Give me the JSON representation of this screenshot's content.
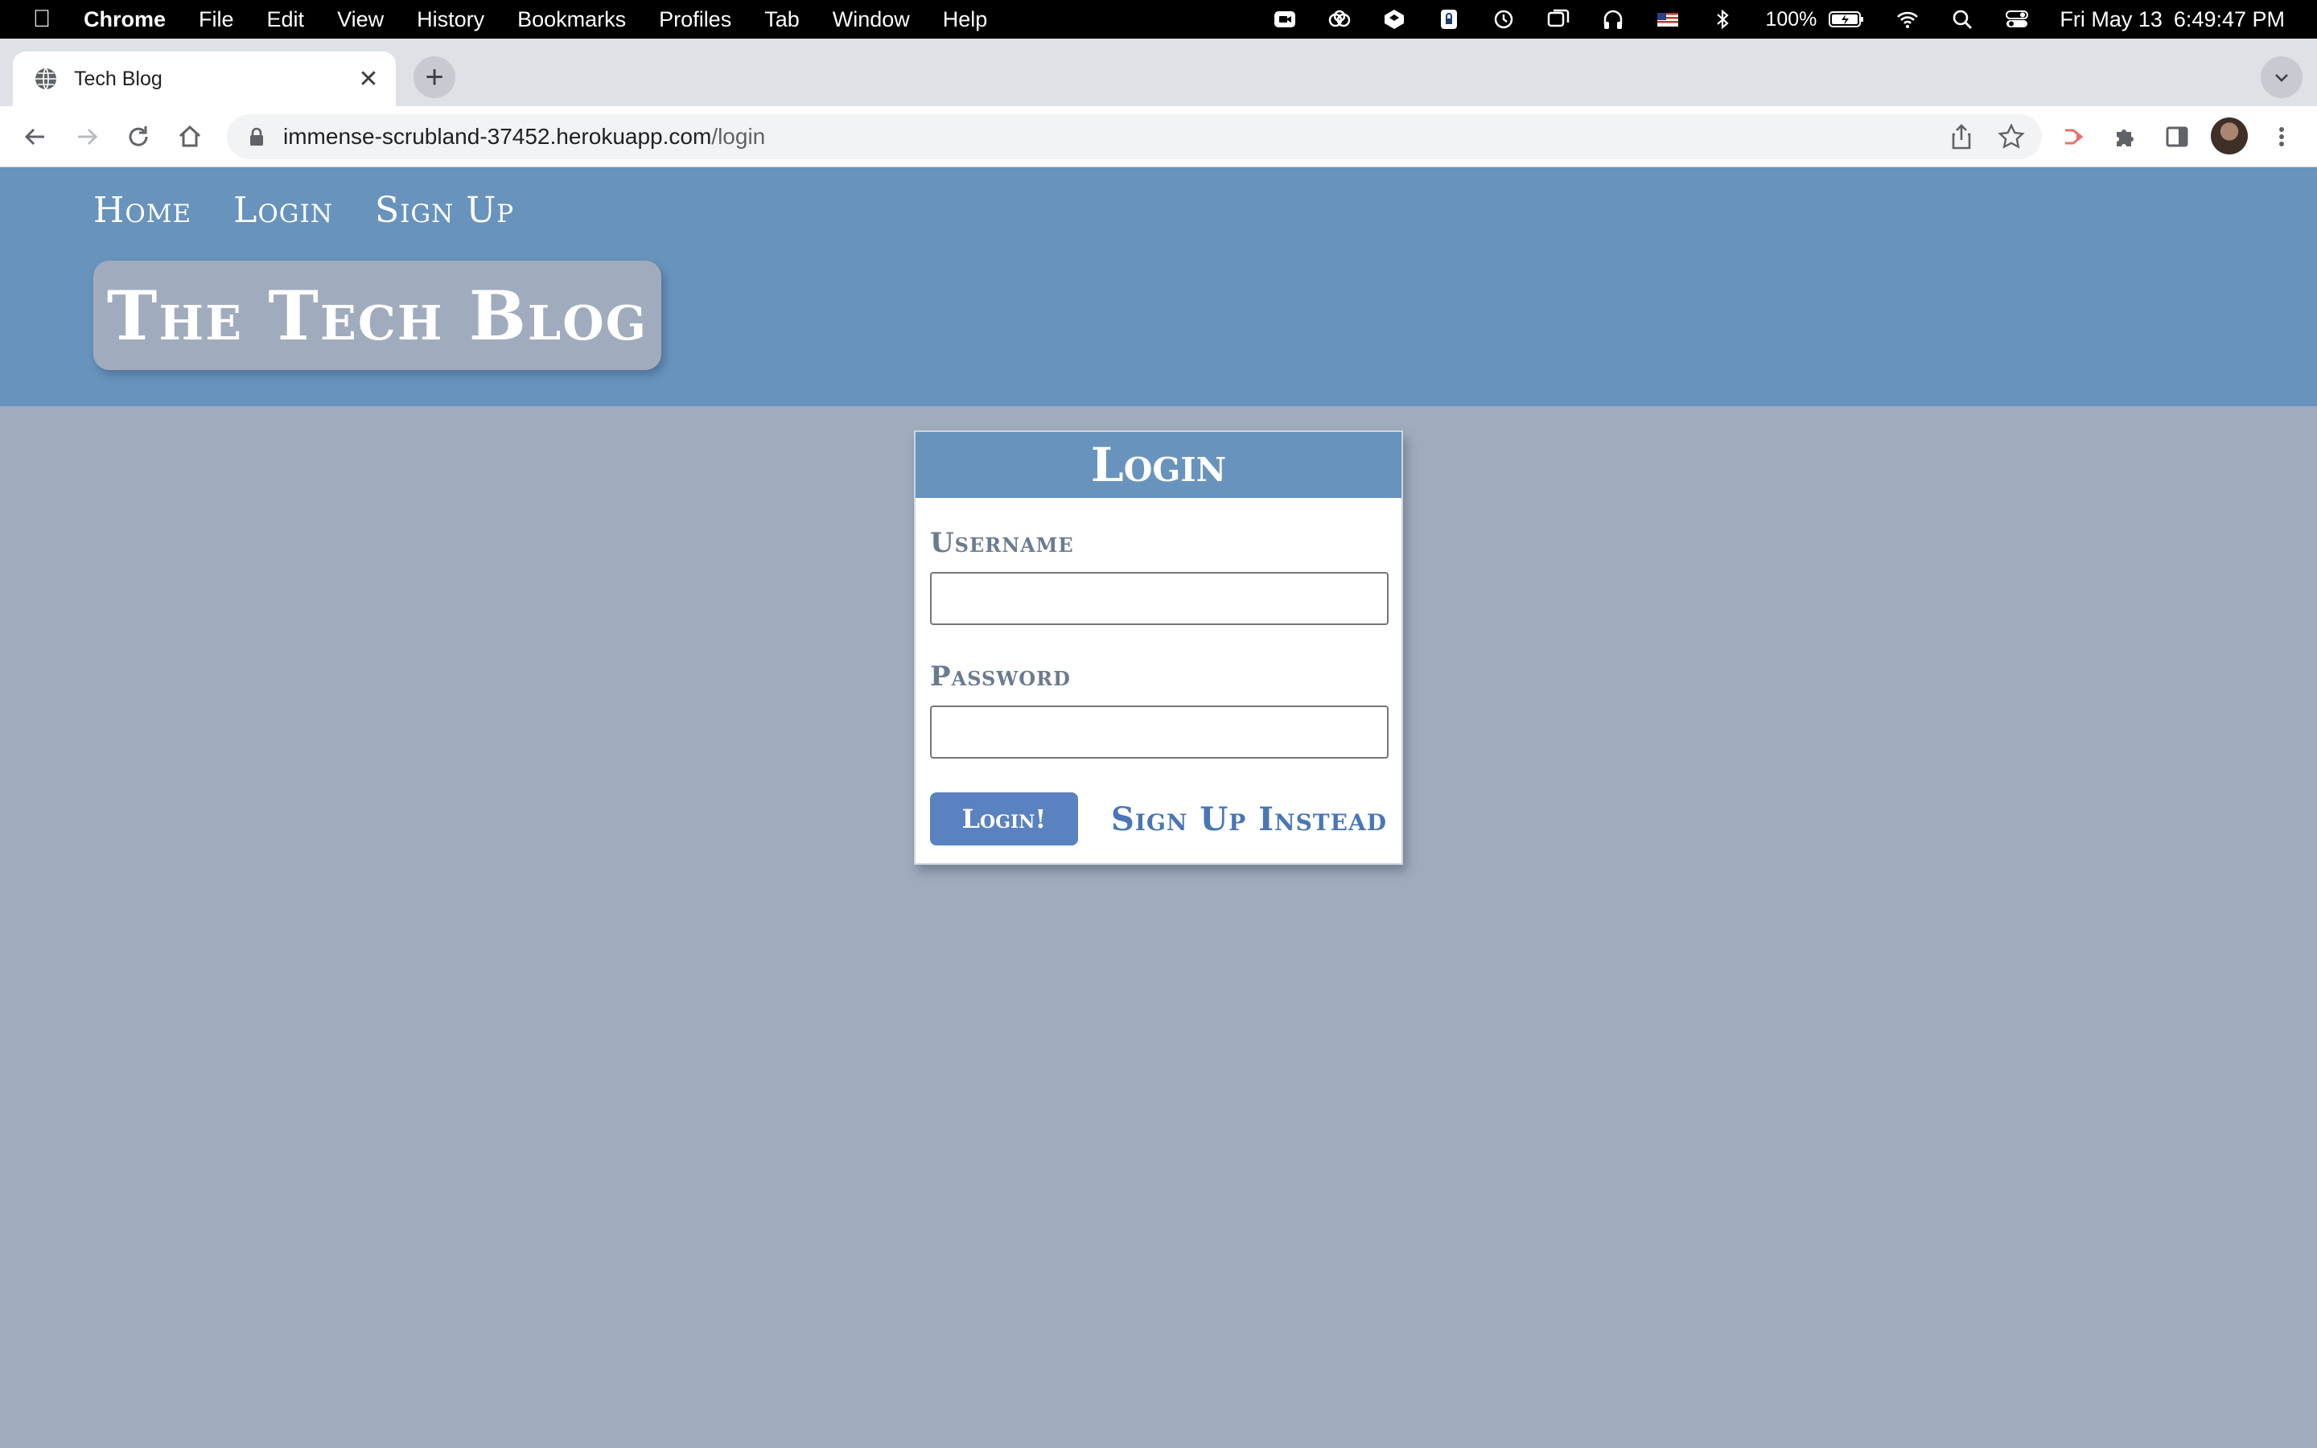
{
  "menubar": {
    "app": "Chrome",
    "items": [
      "File",
      "Edit",
      "View",
      "History",
      "Bookmarks",
      "Profiles",
      "Tab",
      "Window",
      "Help"
    ],
    "battery": "100%",
    "date": "Fri May 13",
    "time": "6:49:47 PM"
  },
  "browser": {
    "tab_title": "Tech Blog",
    "url_host": "immense-scrubland-37452.herokuapp.com",
    "url_path": "/login"
  },
  "site": {
    "nav": [
      "Home",
      "Login",
      "Sign Up"
    ],
    "brand": "The Tech Blog"
  },
  "login_card": {
    "title": "Login",
    "username_label": "Username",
    "username_value": "",
    "password_label": "Password",
    "password_value": "",
    "submit_label": "Login!",
    "signup_link": "Sign Up Instead"
  },
  "colors": {
    "header": "#6893bd",
    "page_bg": "#a0acbd",
    "button": "#5a82c0",
    "link": "#4a76b6"
  }
}
